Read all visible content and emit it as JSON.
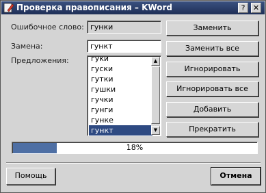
{
  "window": {
    "title": "Проверка правописания – KWord"
  },
  "fields": {
    "misspelled_label": "Ошибочное слово:",
    "misspelled_value": "гунки",
    "replacement_label": "Замена:",
    "replacement_value": "гункт",
    "suggestions_label": "Предложения:"
  },
  "suggestions": [
    "гуки",
    "гуски",
    "гутки",
    "гушки",
    "гучки",
    "гунги",
    "гунке",
    "гункт"
  ],
  "selected_suggestion": "гункт",
  "buttons": {
    "replace": "Заменить",
    "replace_all": "Заменить все",
    "ignore": "Игнорировать",
    "ignore_all": "Игнорировать все",
    "add": "Добавить",
    "stop": "Прекратить",
    "help": "Помощь",
    "cancel": "Отмена"
  },
  "progress": {
    "percent": 18,
    "label": "18%"
  },
  "titlebar_buttons": {
    "help": "?",
    "close": "✕"
  },
  "colors": {
    "title_bg": "#26365f",
    "selection": "#2e4a82",
    "progress_fill": "#4e6fa4"
  }
}
